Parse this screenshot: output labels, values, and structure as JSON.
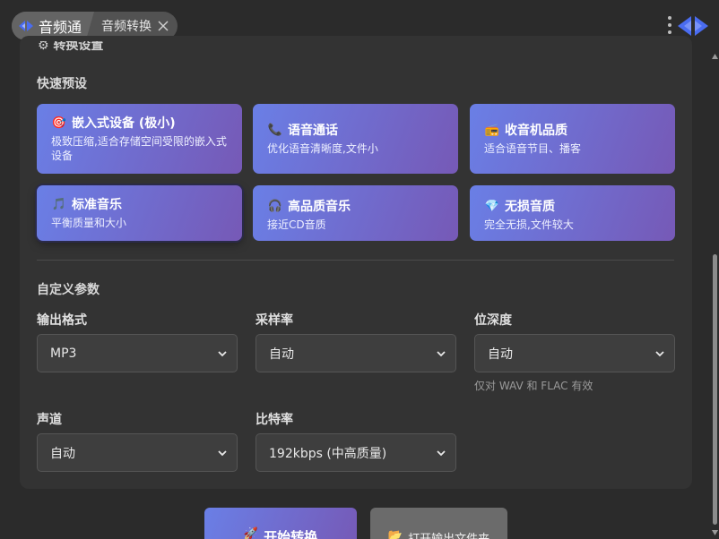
{
  "titlebar": {
    "app_tab_label": "音频通",
    "sub_tab_label": "音频转换",
    "app_icon": "diamond-arrows-icon",
    "accent": "#4a6cf0"
  },
  "quick_presets": {
    "title": "快速预设",
    "items": [
      {
        "icon": "🎯",
        "title": "嵌入式设备 (极小)",
        "desc": "极致压缩,适合存储空间受限的嵌入式设备"
      },
      {
        "icon": "📞",
        "title": "语音通话",
        "desc": "优化语音清晰度,文件小"
      },
      {
        "icon": "📻",
        "title": "收音机品质",
        "desc": "适合语音节目、播客"
      },
      {
        "icon": "🎵",
        "title": "标准音乐",
        "desc": "平衡质量和大小"
      },
      {
        "icon": "🎧",
        "title": "高品质音乐",
        "desc": "接近CD音质"
      },
      {
        "icon": "💎",
        "title": "无损音质",
        "desc": "完全无损,文件较大"
      }
    ]
  },
  "custom_params": {
    "title": "自定义参数",
    "output_format": {
      "label": "输出格式",
      "value": "MP3"
    },
    "sample_rate": {
      "label": "采样率",
      "value": "自动"
    },
    "bit_depth": {
      "label": "位深度",
      "value": "自动",
      "hint": "仅对 WAV 和 FLAC 有效"
    },
    "channels": {
      "label": "声道",
      "value": "自动"
    },
    "bitrate": {
      "label": "比特率",
      "value": "192kbps (中高质量)"
    }
  },
  "actions": {
    "start_icon": "🚀",
    "start_label": "开始转换",
    "open_folder_icon": "📂",
    "open_folder_label": "打开输出文件夹"
  },
  "colors": {
    "preset_gradient_start": "#6a7fe6",
    "preset_gradient_end": "#7659b6",
    "background": "#2b2b2b",
    "panel": "#333333"
  }
}
